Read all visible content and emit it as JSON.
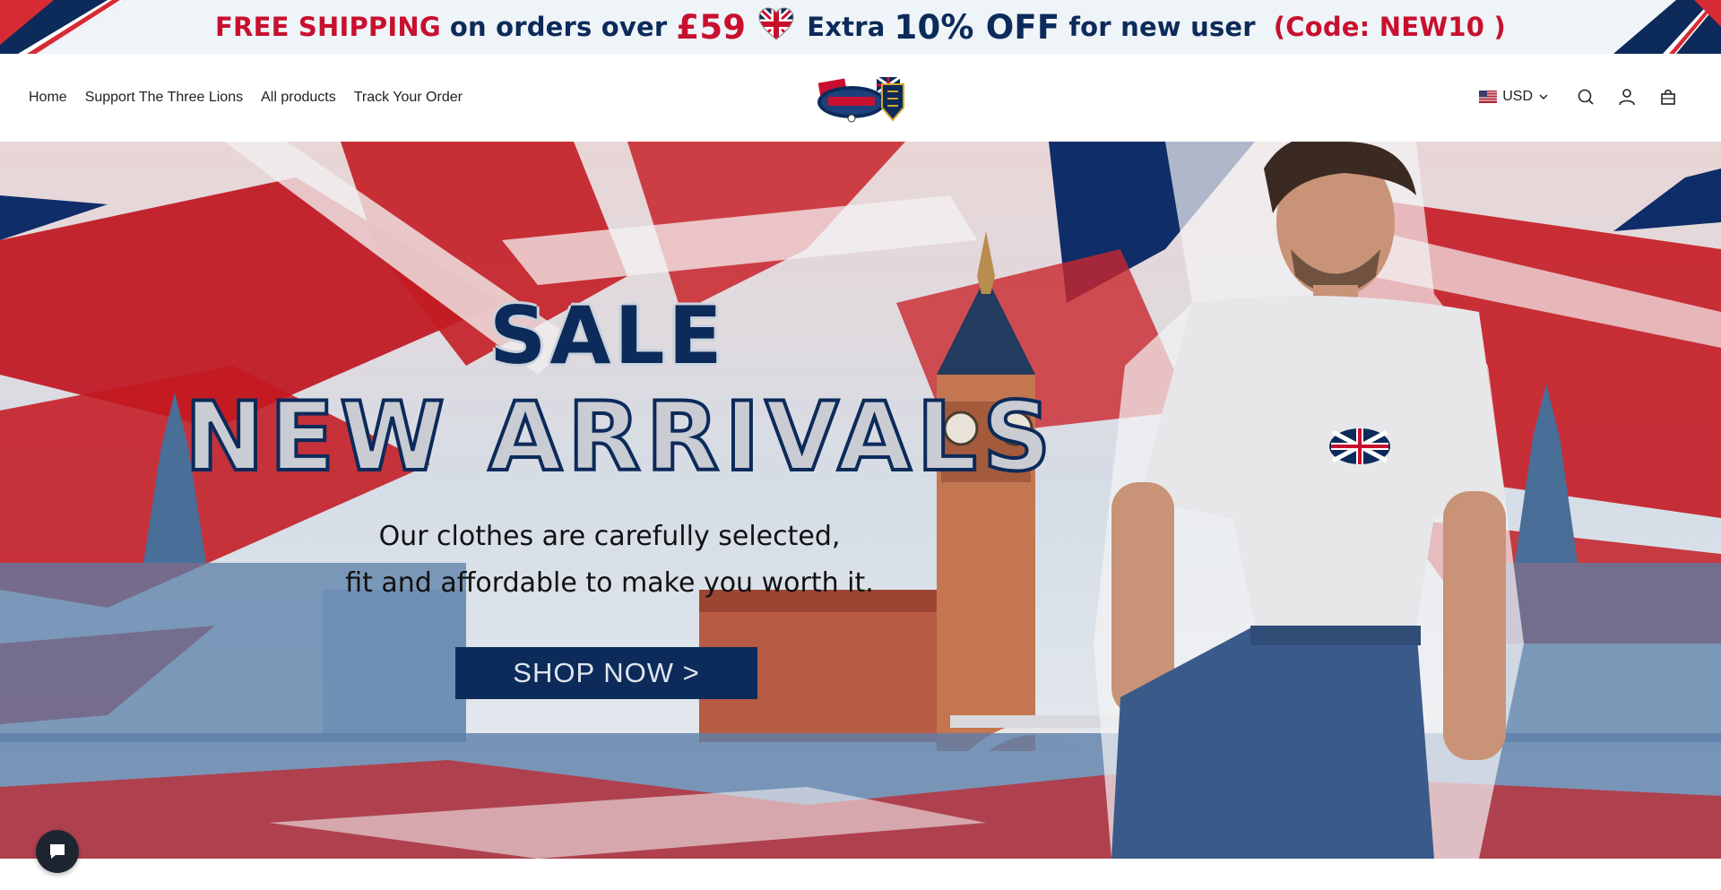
{
  "announcement": {
    "part1": "FREE SHIPPING",
    "part2": "on orders over",
    "part3": "£59",
    "part4": "Extra",
    "part5": "10% OFF",
    "part6": "for new user",
    "part7": "(Code: NEW10 )"
  },
  "nav": {
    "items": [
      "Home",
      "Support The Three Lions",
      "All products",
      "Track Your Order"
    ]
  },
  "header": {
    "currency": "USD"
  },
  "hero": {
    "sale": "SALE",
    "headline": "NEW ARRIVALS",
    "line1": "Our clothes are carefully selected,",
    "line2": "fit and affordable to make you worth it.",
    "cta": "SHOP NOW >"
  },
  "colors": {
    "navy": "#0c2a5a",
    "red": "#c8102e"
  }
}
